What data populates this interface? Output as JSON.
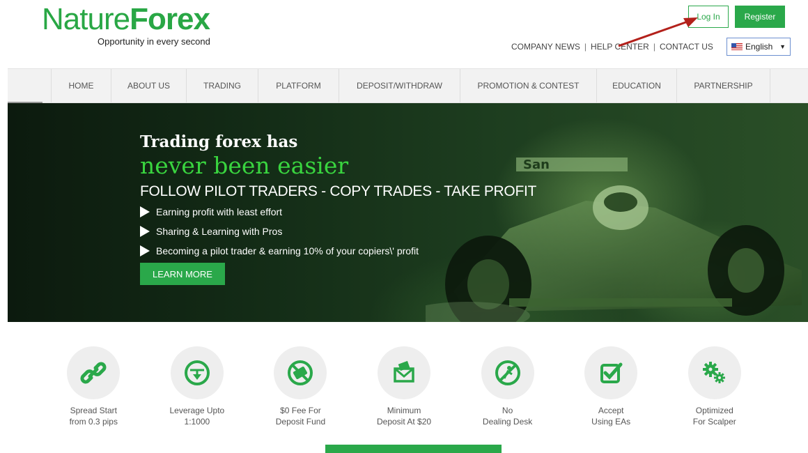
{
  "header": {
    "logo_part1": "Nature",
    "logo_part2": "Fore",
    "logo_part3": "x",
    "tagline": "Opportunity in every second",
    "login_label": "Log In",
    "register_label": "Register",
    "toplinks": [
      "COMPANY NEWS",
      "HELP CENTER",
      "CONTACT US"
    ],
    "separator": "|",
    "language": "English",
    "accent_color": "#2aa84a"
  },
  "nav": {
    "items": [
      {
        "label": "HOME"
      },
      {
        "label": "ABOUT US"
      },
      {
        "label": "TRADING"
      },
      {
        "label": "PLATFORM"
      },
      {
        "label": "DEPOSIT/WITHDRAW"
      },
      {
        "label": "PROMOTION & CONTEST"
      },
      {
        "label": "EDUCATION"
      },
      {
        "label": "PARTNERSHIP"
      }
    ]
  },
  "hero": {
    "title_line1": "Trading forex has",
    "title_line2": "never been easier",
    "subtitle": "FOLLOW PILOT TRADERS - COPY TRADES - TAKE PROFIT",
    "bullets": [
      "Earning profit with least effort",
      "Sharing & Learning with Pros",
      "Becoming a pilot trader & earning 10% of your copiers\\' profit"
    ],
    "button_label": "LEARN MORE",
    "car_text": "San"
  },
  "features": [
    {
      "icon": "link-icon",
      "line1": "Spread Start",
      "line2": "from 0.3 pips"
    },
    {
      "icon": "scale-icon",
      "line1": "Leverage Upto",
      "line2": "1:1000"
    },
    {
      "icon": "no-fee-icon",
      "line1": "$0 Fee For",
      "line2": "Deposit Fund"
    },
    {
      "icon": "money-envelope-icon",
      "line1": "Minimum",
      "line2": "Deposit At $20"
    },
    {
      "icon": "no-dealing-desk-icon",
      "line1": "No",
      "line2": "Dealing Desk"
    },
    {
      "icon": "checkbox-icon",
      "line1": "Accept",
      "line2": "Using EAs"
    },
    {
      "icon": "gears-icon",
      "line1": "Optimized",
      "line2": "For Scalper"
    }
  ]
}
